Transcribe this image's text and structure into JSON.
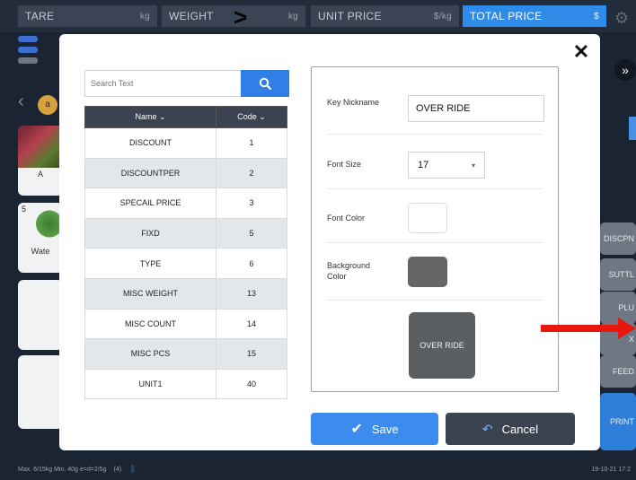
{
  "topbar": {
    "tare": {
      "label": "TARE",
      "unit": "kg"
    },
    "weight": {
      "label": "WEIGHT",
      "unit": "kg"
    },
    "unit_price": {
      "label": "UNIT PRICE",
      "unit": "$/kg"
    },
    "total_price": {
      "label": "TOTAL PRICE",
      "unit": "$"
    },
    "pointer": ">"
  },
  "tiles": [
    {
      "label": "A"
    },
    {
      "number": "5",
      "label": "Wate"
    }
  ],
  "right_buttons": [
    "DISCPN",
    "SUTTL",
    "PLU",
    "X",
    "FEED",
    "PRINT"
  ],
  "expand_glyph": "»",
  "statusbar": {
    "info": "Max. 6/15kg  Min. 40g  e=d=2/5g",
    "code": "(4)",
    "datetime": "19-10-21 17:2"
  },
  "modal": {
    "search": {
      "placeholder": "Search Text"
    },
    "table": {
      "headers": [
        "Name",
        "Code"
      ],
      "rows": [
        {
          "name": "DISCOUNT",
          "code": "1"
        },
        {
          "name": "DISCOUNTPER",
          "code": "2"
        },
        {
          "name": "SPECAIL PRICE",
          "code": "3"
        },
        {
          "name": "FIXD",
          "code": "5"
        },
        {
          "name": "TYPE",
          "code": "6"
        },
        {
          "name": "MISC WEIGHT",
          "code": "13"
        },
        {
          "name": "MISC COUNT",
          "code": "14"
        },
        {
          "name": "MISC PCS",
          "code": "15"
        },
        {
          "name": "UNIT1",
          "code": "40"
        }
      ]
    },
    "form": {
      "key_nickname_label": "Key Nickname",
      "key_nickname_value": "OVER RIDE",
      "font_size_label": "Font Size",
      "font_size_value": "17",
      "font_color_label": "Font Color",
      "font_color": "#ffffff",
      "background_color_label": "Background Color",
      "background_color": "#636567",
      "preview_text": "OVER RIDE"
    },
    "save_label": "Save",
    "cancel_label": "Cancel"
  },
  "colors": {
    "accent_blue": "#3c8cf0",
    "header_dark": "#3b4250",
    "annotation_red": "#e8160c"
  }
}
